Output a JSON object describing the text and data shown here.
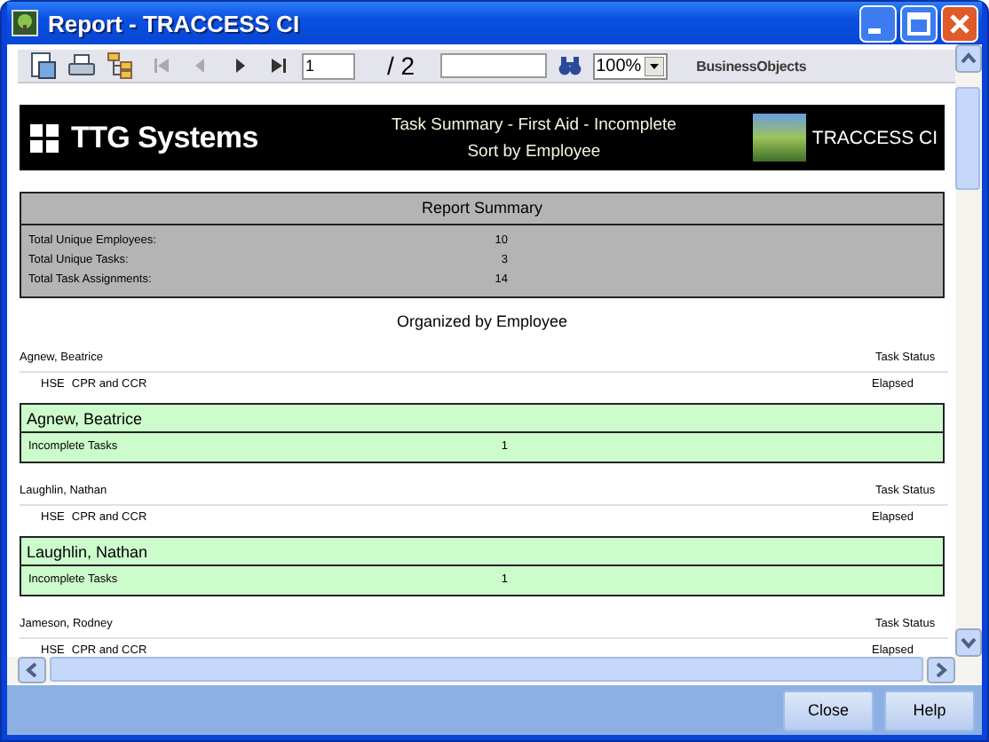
{
  "window": {
    "title": "Report - TRACCESS CI"
  },
  "toolbar": {
    "page": "1",
    "page_total": "/ 2",
    "zoom": "100%",
    "brand": "BusinessObjects"
  },
  "banner": {
    "company": "TTG Systems",
    "title": "Task Summary - First Aid - Incomplete",
    "subtitle": "Sort by Employee",
    "product": "TRACCESS CI"
  },
  "summary": {
    "title": "Report Summary",
    "rows": [
      {
        "label": "Total Unique Employees:",
        "value": "10"
      },
      {
        "label": "Total Unique Tasks:",
        "value": "3"
      },
      {
        "label": "Total Task Assignments:",
        "value": "14"
      }
    ]
  },
  "section_title": "Organized by Employee",
  "employees": [
    {
      "name": "Agnew, Beatrice",
      "status_header": "Task Status",
      "tasks": [
        {
          "code": "HSE",
          "name": "CPR and CCR",
          "status": "Elapsed"
        }
      ],
      "total": {
        "name": "Agnew, Beatrice",
        "label": "Incomplete Tasks",
        "value": "1"
      }
    },
    {
      "name": "Laughlin, Nathan",
      "status_header": "Task Status",
      "tasks": [
        {
          "code": "HSE",
          "name": "CPR and CCR",
          "status": "Elapsed"
        }
      ],
      "total": {
        "name": "Laughlin, Nathan",
        "label": "Incomplete Tasks",
        "value": "1"
      }
    },
    {
      "name": "Jameson, Rodney",
      "status_header": "Task Status",
      "tasks": [
        {
          "code": "HSE",
          "name": "CPR and CCR",
          "status": "Elapsed"
        }
      ]
    }
  ],
  "buttons": [
    "Close",
    "Help"
  ]
}
